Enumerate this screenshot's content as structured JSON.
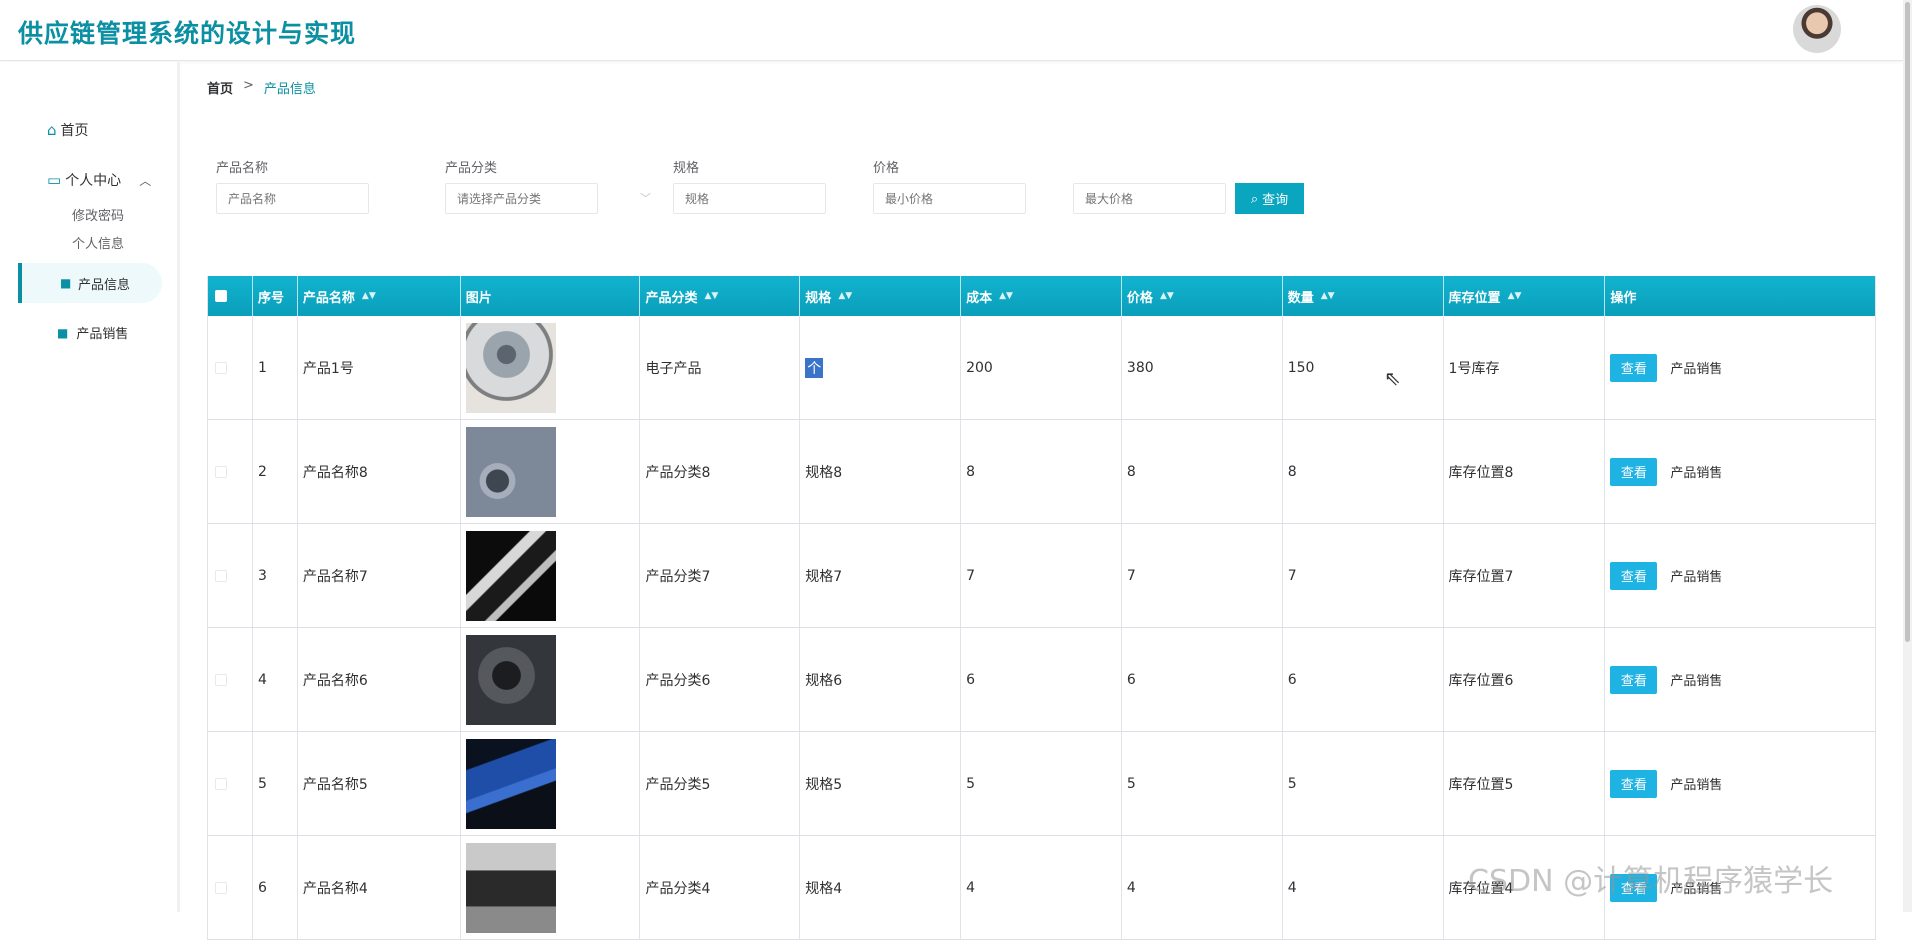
{
  "header": {
    "title": "供应链管理系统的设计与实现"
  },
  "sidebar": {
    "home": "首页",
    "center": "个人中心",
    "center_children": [
      "修改密码",
      "个人信息"
    ],
    "product_info": "产品信息",
    "product_sales": "产品销售"
  },
  "breadcrumb": {
    "home": "首页",
    "separator": ">",
    "current": "产品信息"
  },
  "search": {
    "name_label": "产品名称",
    "name_placeholder": "产品名称",
    "category_label": "产品分类",
    "category_placeholder": "请选择产品分类",
    "spec_label": "规格",
    "spec_placeholder": "规格",
    "price_label": "价格",
    "min_price_placeholder": "最小价格",
    "max_price_placeholder": "最大价格",
    "search_button": "查询"
  },
  "table": {
    "columns": [
      "序号",
      "产品名称",
      "图片",
      "产品分类",
      "规格",
      "成本",
      "价格",
      "数量",
      "库存位置",
      "操作"
    ],
    "view_label": "查看",
    "sale_label": "产品销售",
    "rows": [
      {
        "index": "1",
        "name": "产品1号",
        "category": "电子产品",
        "spec": "个",
        "cost": "200",
        "price": "380",
        "qty": "150",
        "location": "1号库存"
      },
      {
        "index": "2",
        "name": "产品名称8",
        "category": "产品分类8",
        "spec": "规格8",
        "cost": "8",
        "price": "8",
        "qty": "8",
        "location": "库存位置8"
      },
      {
        "index": "3",
        "name": "产品名称7",
        "category": "产品分类7",
        "spec": "规格7",
        "cost": "7",
        "price": "7",
        "qty": "7",
        "location": "库存位置7"
      },
      {
        "index": "4",
        "name": "产品名称6",
        "category": "产品分类6",
        "spec": "规格6",
        "cost": "6",
        "price": "6",
        "qty": "6",
        "location": "库存位置6"
      },
      {
        "index": "5",
        "name": "产品名称5",
        "category": "产品分类5",
        "spec": "规格5",
        "cost": "5",
        "price": "5",
        "qty": "5",
        "location": "库存位置5"
      },
      {
        "index": "6",
        "name": "产品名称4",
        "category": "产品分类4",
        "spec": "规格4",
        "cost": "4",
        "price": "4",
        "qty": "4",
        "location": "库存位置4"
      }
    ]
  },
  "watermark": "CSDN @计算机程序猿学长",
  "colors": {
    "brand": "#0a8fa3",
    "table_header": "#0aa6c0",
    "view_button": "#1eb3e3"
  }
}
